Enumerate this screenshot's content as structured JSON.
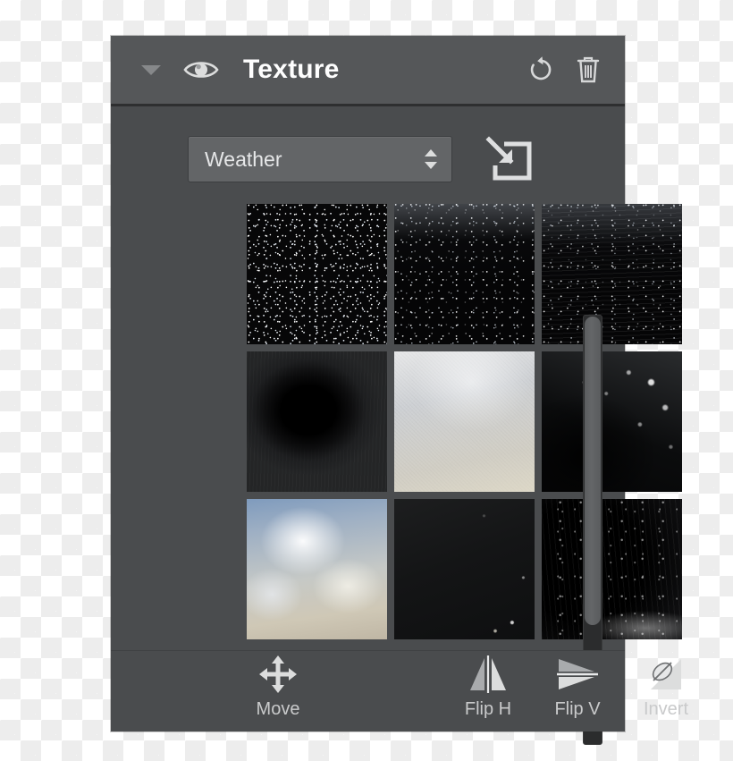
{
  "panel": {
    "title": "Texture",
    "collapse_icon": "chevron-down-icon",
    "visibility_icon": "eye-icon",
    "reset_icon": "reset-rotate-icon",
    "delete_icon": "trash-icon"
  },
  "source": {
    "selected": "Weather",
    "options": [
      "Weather"
    ],
    "stepper_icon": "up-down-stepper-icon",
    "import_icon": "import-arrow-into-box-icon"
  },
  "grid": {
    "selected_index": 0,
    "selection_color": "#199ee6",
    "thumbnails": [
      {
        "name": "dense-starfield-texture",
        "style": "tex-stars-dense"
      },
      {
        "name": "rain-streaks-texture",
        "style": "tex-rain-a"
      },
      {
        "name": "rain-streaks-variant-texture",
        "style": "tex-rain-b"
      },
      {
        "name": "dark-vignette-texture",
        "style": "tex-vignette-dark"
      },
      {
        "name": "bright-grain-texture",
        "style": "tex-bright-grain"
      },
      {
        "name": "bokeh-spots-texture",
        "style": "tex-bokeh"
      },
      {
        "name": "cloudy-sky-texture",
        "style": "tex-sky"
      },
      {
        "name": "near-black-texture",
        "style": "tex-near-black"
      },
      {
        "name": "scratched-dark-texture",
        "style": "tex-scratch"
      }
    ]
  },
  "scrollbar": {
    "orientation": "vertical",
    "thumb_position_percent": 0,
    "thumb_size_percent": 72
  },
  "footer": {
    "tools": [
      {
        "id": "move",
        "label": "Move",
        "icon": "move-four-arrows-icon"
      },
      {
        "id": "fliph",
        "label": "Flip H",
        "icon": "flip-horizontal-icon"
      },
      {
        "id": "flipv",
        "label": "Flip V",
        "icon": "flip-vertical-icon"
      },
      {
        "id": "invert",
        "label": "Invert",
        "icon": "invert-icon"
      }
    ]
  },
  "colors": {
    "panel_background": "#4a4c4e",
    "header_background": "#555759",
    "accent": "#199ee6",
    "text_primary": "#fefefe",
    "text_secondary": "#c9cacb"
  }
}
